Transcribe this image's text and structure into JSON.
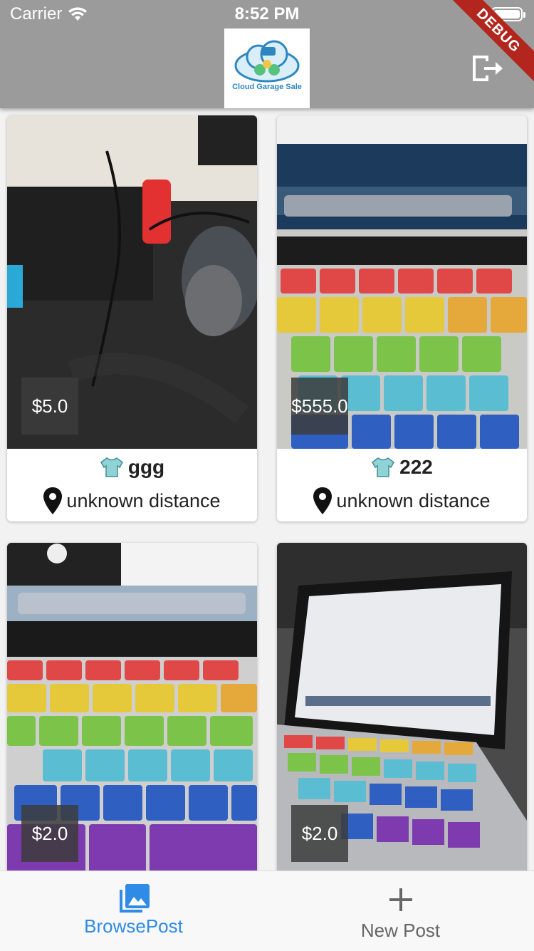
{
  "status_bar": {
    "carrier": "Carrier",
    "time": "8:52 PM"
  },
  "debug_banner": "DEBUG",
  "app_bar": {
    "logo_text": "Cloud Garage Sale",
    "logout_icon": "logout-icon"
  },
  "posts": [
    {
      "price": "$5.0",
      "title": "ggg",
      "distance": "unknown distance",
      "category_icon": "shirt-icon"
    },
    {
      "price": "$555.0",
      "title": "222",
      "distance": "unknown distance",
      "category_icon": "shirt-icon"
    },
    {
      "price": "$2.0",
      "title": "",
      "distance": "",
      "category_icon": ""
    },
    {
      "price": "$2.0",
      "title": "",
      "distance": "",
      "category_icon": ""
    }
  ],
  "bottom_nav": {
    "items": [
      {
        "label": "BrowsePost",
        "icon": "photo-library-icon",
        "active": true
      },
      {
        "label": "New Post",
        "icon": "plus-icon",
        "active": false
      }
    ]
  },
  "colors": {
    "appbar": "#9b9b9b",
    "active_tab": "#2f8be6",
    "inactive_tab": "#666666",
    "debug": "#b3261e"
  }
}
